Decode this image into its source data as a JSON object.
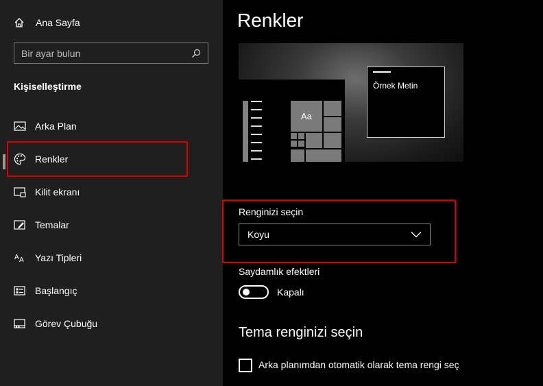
{
  "sidebar": {
    "home_label": "Ana Sayfa",
    "search_placeholder": "Bir ayar bulun",
    "section_title": "Kişiselleştirme",
    "items": [
      {
        "label": "Arka Plan",
        "icon": "picture-icon"
      },
      {
        "label": "Renkler",
        "icon": "palette-icon",
        "active": true
      },
      {
        "label": "Kilit ekranı",
        "icon": "lock-screen-icon"
      },
      {
        "label": "Temalar",
        "icon": "themes-icon"
      },
      {
        "label": "Yazı Tipleri",
        "icon": "fonts-icon"
      },
      {
        "label": "Başlangıç",
        "icon": "start-icon"
      },
      {
        "label": "Görev Çubuğu",
        "icon": "taskbar-icon"
      }
    ]
  },
  "main": {
    "title": "Renkler",
    "preview": {
      "sample_text": "Örnek Metin",
      "tile_text": "Aa"
    },
    "color_choice": {
      "label": "Renginizi seçin",
      "selected": "Koyu"
    },
    "transparency": {
      "label": "Saydamlık efektleri",
      "state": "Kapalı"
    },
    "accent": {
      "title": "Tema renginizi seçin",
      "auto_checkbox_label": "Arka planımdan otomatik olarak tema rengi seç"
    }
  },
  "colors": {
    "highlight": "#e00000",
    "sidebar_bg": "#1f1f1f",
    "main_bg": "#000000"
  }
}
